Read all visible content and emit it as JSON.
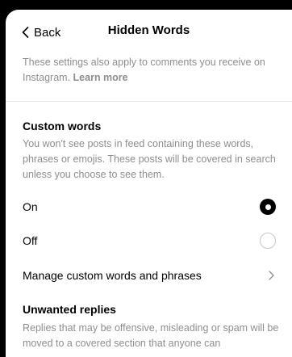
{
  "header": {
    "back_label": "Back",
    "title": "Hidden Words"
  },
  "notice": {
    "text": "These settings also apply to comments you receive on Instagram.",
    "link": "Learn more"
  },
  "custom_words": {
    "title": "Custom words",
    "description": "You won't see posts in feed containing these words, phrases or emojis. These posts will be covered in search unless you choose to see them.",
    "options": [
      {
        "label": "On",
        "selected": true
      },
      {
        "label": "Off",
        "selected": false
      }
    ],
    "manage_label": "Manage custom words and phrases"
  },
  "unwanted_replies": {
    "title": "Unwanted replies",
    "description": "Replies that may be offensive, misleading or spam will be moved to a covered section that anyone can"
  },
  "colors": {
    "background": "#000000",
    "sheet": "#ffffff",
    "secondary_text": "#8e8e8e",
    "divider": "#e4e4e4"
  }
}
